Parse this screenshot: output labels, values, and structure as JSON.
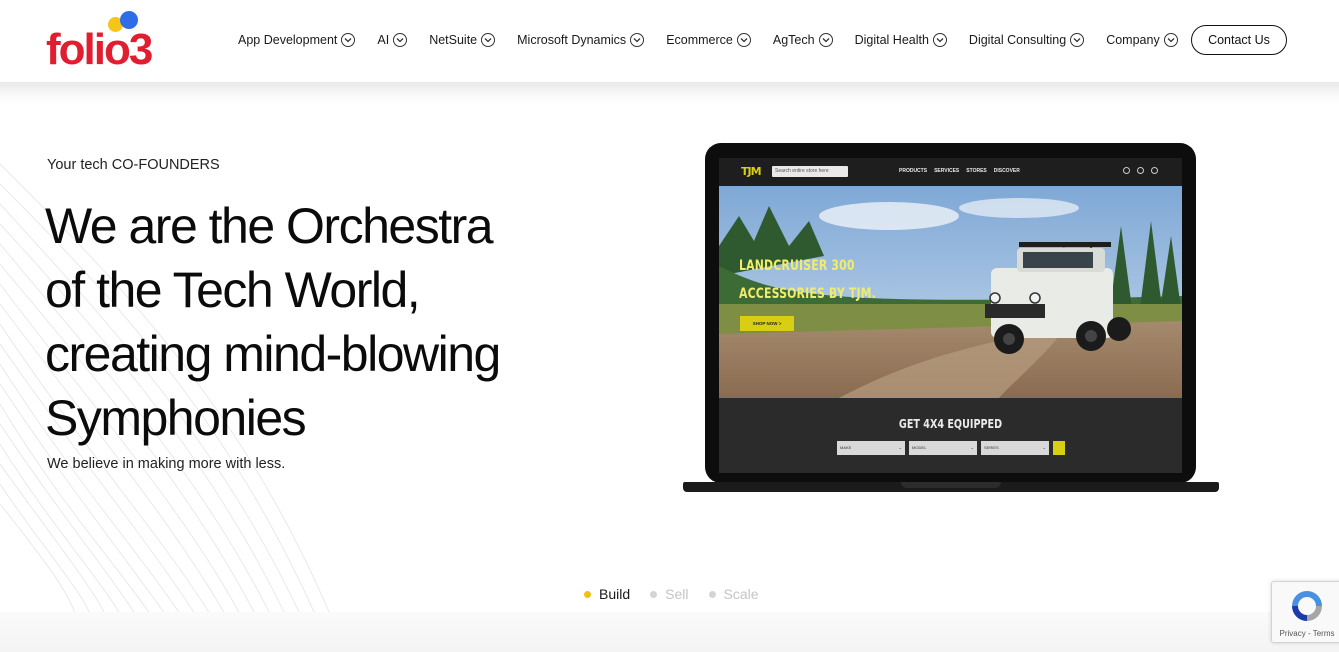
{
  "brand": {
    "logo_text": "folio3",
    "red": "#e01e2f",
    "yellow": "#f6c516",
    "blue": "#2f6de8"
  },
  "nav": {
    "items": [
      {
        "label": "App Development"
      },
      {
        "label": "AI"
      },
      {
        "label": "NetSuite"
      },
      {
        "label": "Microsoft Dynamics"
      },
      {
        "label": "Ecommerce"
      },
      {
        "label": "AgTech"
      },
      {
        "label": "Digital Health"
      },
      {
        "label": "Digital Consulting"
      },
      {
        "label": "Company"
      }
    ],
    "contact_label": "Contact Us"
  },
  "hero": {
    "eyebrow": "Your tech CO-FOUNDERS",
    "title_lines": [
      "We are the Orchestra",
      "of the Tech World,",
      "creating mind-blowing",
      "Symphonies"
    ],
    "subtitle": "We believe in making more with less."
  },
  "laptop_screen": {
    "logo": "TJM",
    "search_placeholder": "Search entire store here",
    "menu": [
      "PRODUCTS",
      "SERVICES",
      "STORES",
      "DISCOVER"
    ],
    "hero_lines": [
      "LANDCRUISER 300",
      "ACCESSORIES BY TJM."
    ],
    "cta": "SHOP NOW >",
    "equip_title": "GET 4X4 EQUIPPED",
    "selects": [
      "MAKE",
      "MODEL",
      "SERIES"
    ]
  },
  "steps": [
    {
      "label": "Build",
      "active": true
    },
    {
      "label": "Sell",
      "active": false
    },
    {
      "label": "Scale",
      "active": false
    }
  ],
  "recaptcha": {
    "text": "Privacy - Terms"
  }
}
